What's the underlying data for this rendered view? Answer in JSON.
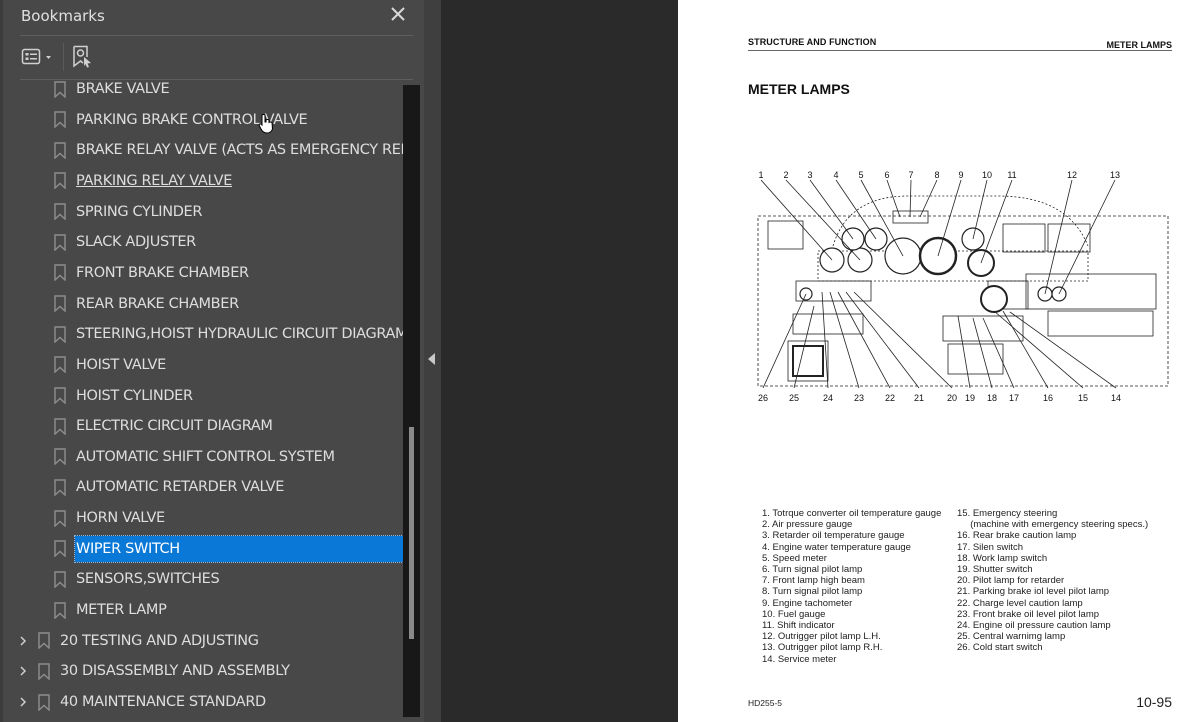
{
  "bookmarks_panel": {
    "title": "Bookmarks",
    "close_icon": "close-icon",
    "toolbar": {
      "options_icon": "list-options-icon",
      "find_current_icon": "find-current-bookmark-icon"
    },
    "items": [
      {
        "label": "BRAKE VALVE",
        "level": "child",
        "state": ""
      },
      {
        "label": "PARKING BRAKE CONTROL VALVE",
        "level": "child",
        "state": ""
      },
      {
        "label": "BRAKE RELAY VALVE (ACTS AS EMERGENCY RELAY)",
        "level": "child",
        "state": ""
      },
      {
        "label": "PARKING RELAY VALVE",
        "level": "child",
        "state": "hover"
      },
      {
        "label": "SPRING CYLINDER",
        "level": "child",
        "state": ""
      },
      {
        "label": "SLACK ADJUSTER",
        "level": "child",
        "state": ""
      },
      {
        "label": "FRONT BRAKE CHAMBER",
        "level": "child",
        "state": ""
      },
      {
        "label": "REAR BRAKE CHAMBER",
        "level": "child",
        "state": ""
      },
      {
        "label": "STEERING,HOIST HYDRAULIC CIRCUIT DIAGRAM",
        "level": "child",
        "state": ""
      },
      {
        "label": "HOIST VALVE",
        "level": "child",
        "state": ""
      },
      {
        "label": "HOIST CYLINDER",
        "level": "child",
        "state": ""
      },
      {
        "label": "ELECTRIC CIRCUIT DIAGRAM",
        "level": "child",
        "state": ""
      },
      {
        "label": "AUTOMATIC SHIFT CONTROL SYSTEM",
        "level": "child",
        "state": ""
      },
      {
        "label": "AUTOMATIC RETARDER VALVE",
        "level": "child",
        "state": ""
      },
      {
        "label": "HORN VALVE",
        "level": "child",
        "state": ""
      },
      {
        "label": "WIPER SWITCH",
        "level": "child",
        "state": "selected"
      },
      {
        "label": "SENSORS,SWITCHES",
        "level": "child",
        "state": ""
      },
      {
        "label": "METER LAMP",
        "level": "child",
        "state": ""
      },
      {
        "label": "20 TESTING AND ADJUSTING",
        "level": "top",
        "state": "collapsed"
      },
      {
        "label": "30 DISASSEMBLY AND ASSEMBLY",
        "level": "top",
        "state": "collapsed"
      },
      {
        "label": "40 MAINTENANCE STANDARD",
        "level": "top",
        "state": "collapsed"
      }
    ],
    "scroll_position": 0.85
  },
  "document_page": {
    "header_left": "STRUCTURE AND FUNCTION",
    "header_right": "METER LAMPS",
    "title": "METER LAMPS",
    "diagram": {
      "description": "Instrument panel diagram",
      "callouts_top": [
        "1",
        "2",
        "3",
        "4",
        "5",
        "6",
        "7",
        "8",
        "9",
        "10",
        "11",
        "12",
        "13"
      ],
      "callouts_bottom": [
        "26",
        "25",
        "24",
        "23",
        "22",
        "21",
        "20",
        "19",
        "18",
        "17",
        "16",
        "15",
        "14"
      ]
    },
    "legend_left": [
      "1. Totrque converter oil temperature gauge",
      "2. Air pressure gauge",
      "3. Retarder oil temperature gauge",
      "4. Engine water temperature gauge",
      "5. Speed meter",
      "6. Turn signal pilot lamp",
      "7. Front lamp high beam",
      "8. Turn signal pilot lamp",
      "9. Engine tachometer",
      "10. Fuel gauge",
      "11. Shift indicator",
      "12. Outrigger pilot lamp L.H.",
      "13. Outrigger pilot lamp R.H.",
      "14. Service meter"
    ],
    "legend_right": [
      "15. Emergency steering",
      "     (machine with emergency steering specs.)",
      "16. Rear brake caution lamp",
      "17. Silen switch",
      "18. Work lamp switch",
      "19. Shutter switch",
      "20. Pilot lamp for retarder",
      "21. Parking brake iol level pilot lamp",
      "22. Charge level caution lamp",
      "23. Front brake oil level pilot lamp",
      "24. Engine oil pressure caution lamp",
      "25. Central warnimg lamp",
      "26. Cold start switch"
    ],
    "footer_left": "HD255-5",
    "footer_right": "10-95"
  },
  "colors": {
    "panel_bg": "#484848",
    "selection": "#0a78d7",
    "viewer_bg": "#2a2a2a"
  }
}
